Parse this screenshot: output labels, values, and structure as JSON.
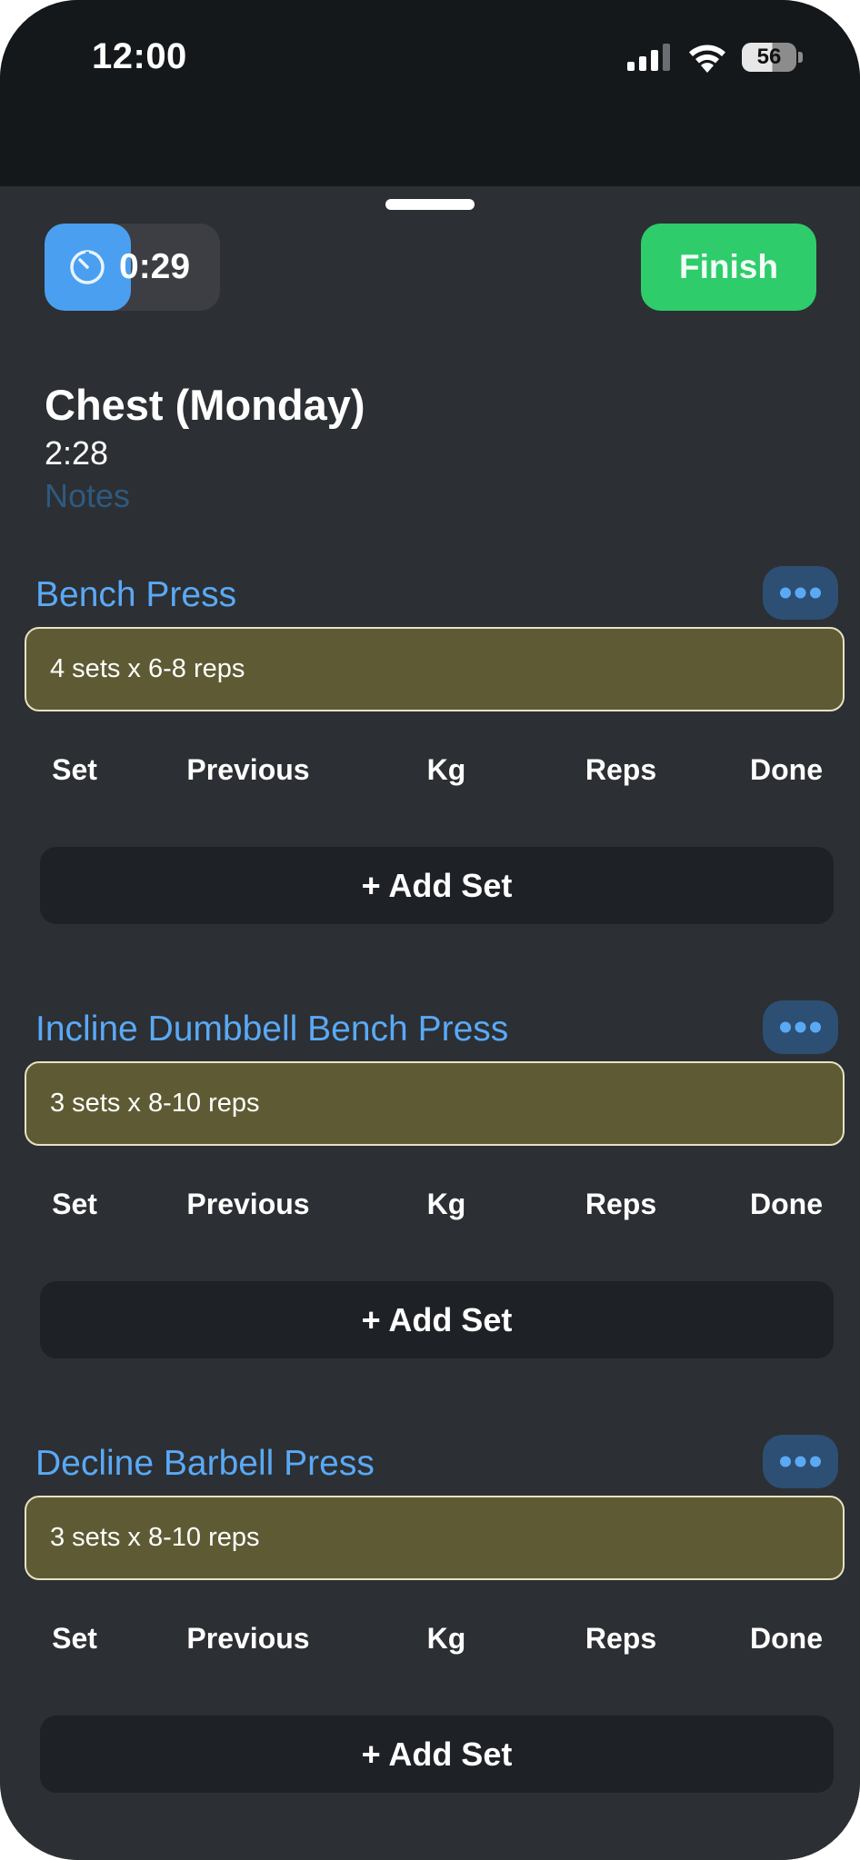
{
  "status_bar": {
    "time": "12:00",
    "battery_level": "56",
    "icons": [
      "cellular-signal-icon",
      "wifi-icon",
      "battery-icon"
    ]
  },
  "header": {
    "rest_timer": "0:29",
    "rest_timer_progress": 0.49,
    "finish_label": "Finish"
  },
  "workout": {
    "title": "Chest (Monday)",
    "duration": "2:28",
    "notes_placeholder": "Notes"
  },
  "columns": [
    "Set",
    "Previous",
    "Kg",
    "Reps",
    "Done"
  ],
  "exercises": [
    {
      "name": "Bench Press",
      "target": "4 sets x 6-8 reps",
      "add_set_label": "+ Add Set"
    },
    {
      "name": "Incline Dumbbell Bench Press",
      "target": "3 sets x 8-10 reps",
      "add_set_label": "+ Add Set"
    },
    {
      "name": "Decline Barbell Press",
      "target": "3 sets x 8-10 reps",
      "add_set_label": "+ Add Set"
    }
  ],
  "colors": {
    "accent_blue": "#5aa9f5",
    "finish_green": "#2ecc6b",
    "target_fill": "#5e5b34",
    "sheet_background": "#2c2f33"
  }
}
